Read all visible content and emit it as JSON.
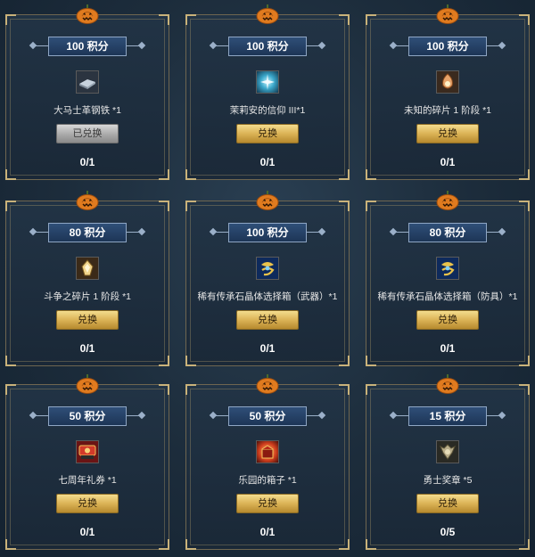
{
  "cards": [
    {
      "points": "100 积分",
      "item": "大马士革钢铁 *1",
      "button": "已兑换",
      "count": "0/1",
      "icon": "steel-ingot-icon"
    },
    {
      "points": "100 积分",
      "item": "茉莉安的信仰 III*1",
      "button": "兑换",
      "count": "0/1",
      "icon": "faith-scroll-icon"
    },
    {
      "points": "100 积分",
      "item": "未知的碎片 1 阶段 *1",
      "button": "兑换",
      "count": "0/1",
      "icon": "unknown-fragment-icon"
    },
    {
      "points": "80 积分",
      "item": "斗争之碎片 1 阶段 *1",
      "button": "兑换",
      "count": "0/1",
      "icon": "struggle-fragment-icon"
    },
    {
      "points": "100 积分",
      "item": "稀有传承石晶体选择箱（武器）*1",
      "button": "兑换",
      "count": "0/1",
      "icon": "crystal-box-weapon-icon"
    },
    {
      "points": "80 积分",
      "item": "稀有传承石晶体选择箱（防具）*1",
      "button": "兑换",
      "count": "0/1",
      "icon": "crystal-box-armor-icon"
    },
    {
      "points": "50 积分",
      "item": "七周年礼券 *1",
      "button": "兑换",
      "count": "0/1",
      "icon": "coupon-icon"
    },
    {
      "points": "50 积分",
      "item": "乐园的箱子 *1",
      "button": "兑换",
      "count": "0/1",
      "icon": "paradise-box-icon"
    },
    {
      "points": "15 积分",
      "item": "勇士奖章 *5",
      "button": "兑换",
      "count": "0/5",
      "icon": "warrior-medal-icon"
    }
  ]
}
